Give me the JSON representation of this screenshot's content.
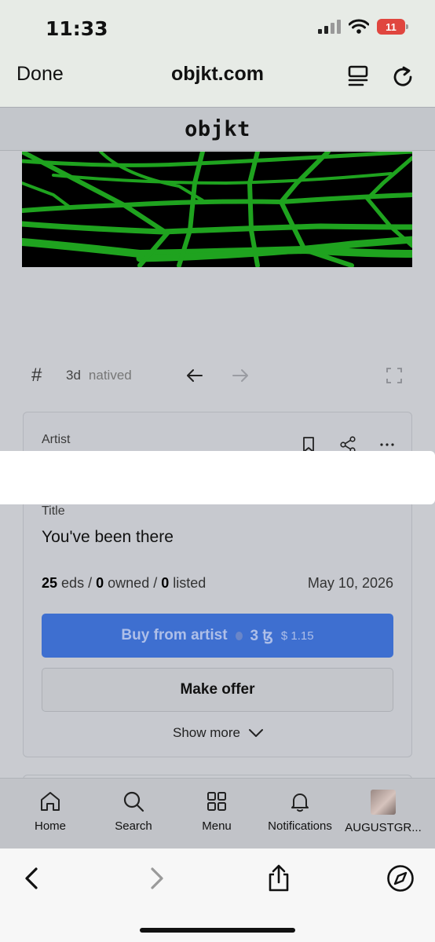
{
  "status_bar": {
    "time": "11:33",
    "battery": "11"
  },
  "browser": {
    "done_label": "Done",
    "host": "objkt.com"
  },
  "site": {
    "logo": "objkt"
  },
  "tags": {
    "hash": "#",
    "items": [
      "3d",
      "natived"
    ]
  },
  "card": {
    "artist_label": "Artist",
    "title_label": "Title",
    "title_value": "You've been there",
    "stats": {
      "editions": "25",
      "editions_label": "eds",
      "owned": "0",
      "owned_label": "owned",
      "listed": "0",
      "listed_label": "listed",
      "sep": "/"
    },
    "date": "May 10, 2026",
    "buy_label": "Buy from artist",
    "buy_price": "3 ꜩ",
    "buy_price_usd": "$ 1.15",
    "offer_label": "Make offer",
    "show_more_label": "Show more"
  },
  "nav": {
    "home": "Home",
    "search": "Search",
    "menu": "Menu",
    "notifications": "Notifications",
    "account": "AUGUSTGR..."
  },
  "colors": {
    "accent": "#3e6fd0",
    "grid_green": "#1fa31f",
    "battery": "#e0463f"
  }
}
